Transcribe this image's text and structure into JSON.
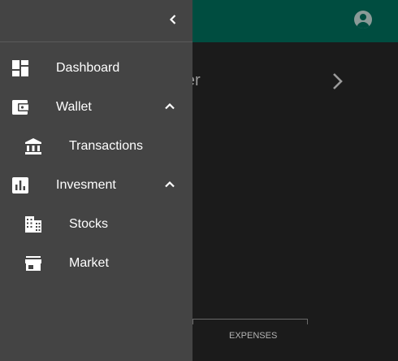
{
  "header": {
    "account_icon": "account-circle-icon"
  },
  "calendar": {
    "month_label": "ember",
    "next_icon": "chevron-right-icon"
  },
  "chart": {
    "category_label": "EXPENSES"
  },
  "drawer": {
    "collapse_icon": "chevron-left-icon",
    "items": [
      {
        "label": "Dashboard",
        "icon": "dashboard-icon"
      },
      {
        "label": "Wallet",
        "icon": "wallet-icon",
        "expanded": true,
        "children": [
          {
            "label": "Transactions",
            "icon": "bank-icon"
          }
        ]
      },
      {
        "label": "Invesment",
        "icon": "bar-chart-icon",
        "expanded": true,
        "children": [
          {
            "label": "Stocks",
            "icon": "building-icon"
          },
          {
            "label": "Market",
            "icon": "store-icon"
          }
        ]
      }
    ]
  },
  "colors": {
    "appbar": "#004d40",
    "drawer": "#444444",
    "background": "#1b1b1b",
    "text": "#ffffff"
  }
}
